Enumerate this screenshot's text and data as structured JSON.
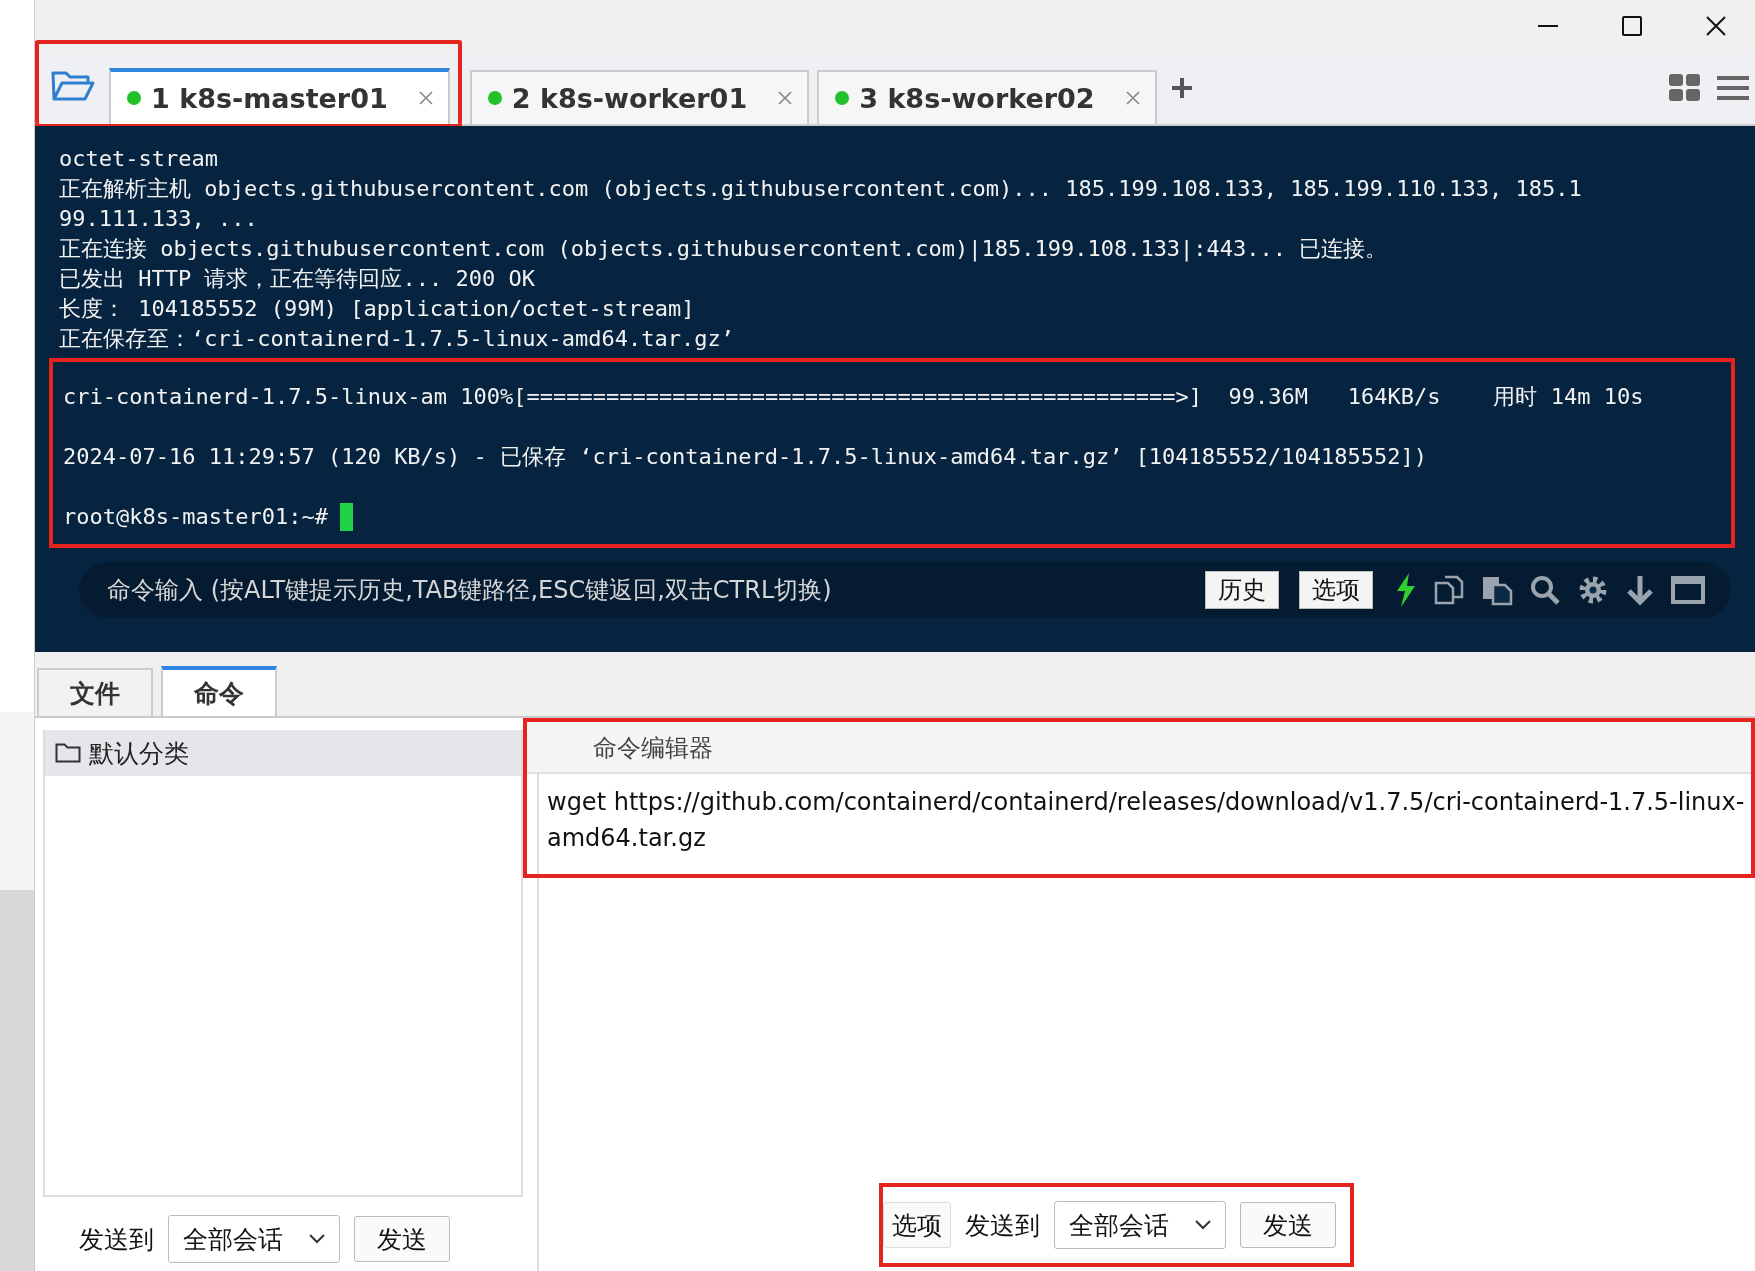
{
  "session_tabs": [
    {
      "number": "1",
      "label": "k8s-master01",
      "selected": true,
      "connected": true,
      "highlighted": true
    },
    {
      "number": "2",
      "label": "k8s-worker01",
      "selected": false,
      "connected": true,
      "highlighted": false
    },
    {
      "number": "3",
      "label": "k8s-worker02",
      "selected": false,
      "connected": true,
      "highlighted": false
    }
  ],
  "terminal": {
    "lines": [
      "octet-stream",
      "正在解析主机 objects.githubusercontent.com (objects.githubusercontent.com)... 185.199.108.133, 185.199.110.133, 185.1",
      "99.111.133, ...",
      "正在连接 objects.githubusercontent.com (objects.githubusercontent.com)|185.199.108.133|:443... 已连接。",
      "已发出 HTTP 请求，正在等待回应... 200 OK",
      "长度： 104185552 (99M) [application/octet-stream]",
      "正在保存至：‘cri-containerd-1.7.5-linux-amd64.tar.gz’"
    ],
    "result": {
      "highlighted": true,
      "lines": [
        "cri-containerd-1.7.5-linux-am 100%[=================================================>]  99.36M   164KB/s    用时 14m 10s",
        "2024-07-16 11:29:57 (120 KB/s) - 已保存 ‘cri-containerd-1.7.5-linux-amd64.tar.gz’ [104185552/104185552])"
      ],
      "prompt": "root@k8s-master01:~#",
      "cursor": true
    },
    "command_input": {
      "placeholder": "命令输入 (按ALT键提示历史,TAB键路径,ESC键返回,双击CTRL切换)",
      "buttons": [
        "历史",
        "选项"
      ]
    }
  },
  "bottom_tabs": [
    {
      "label": "文件",
      "selected": false
    },
    {
      "label": "命令",
      "selected": true
    }
  ],
  "categories": [
    {
      "label": "默认分类",
      "selected": true
    }
  ],
  "editor": {
    "title": "命令编辑器",
    "value": "wget https://github.com/containerd/containerd/releases/download/v1.7.5/cri-containerd-1.7.5-linux-amd64.tar.gz",
    "highlighted": true
  },
  "left_send_bar": {
    "label": "发送到",
    "target": "全部会话",
    "button": "发送"
  },
  "right_send_bar": {
    "options": "选项",
    "label": "发送到",
    "target": "全部会话",
    "button": "发送",
    "highlighted": true
  }
}
